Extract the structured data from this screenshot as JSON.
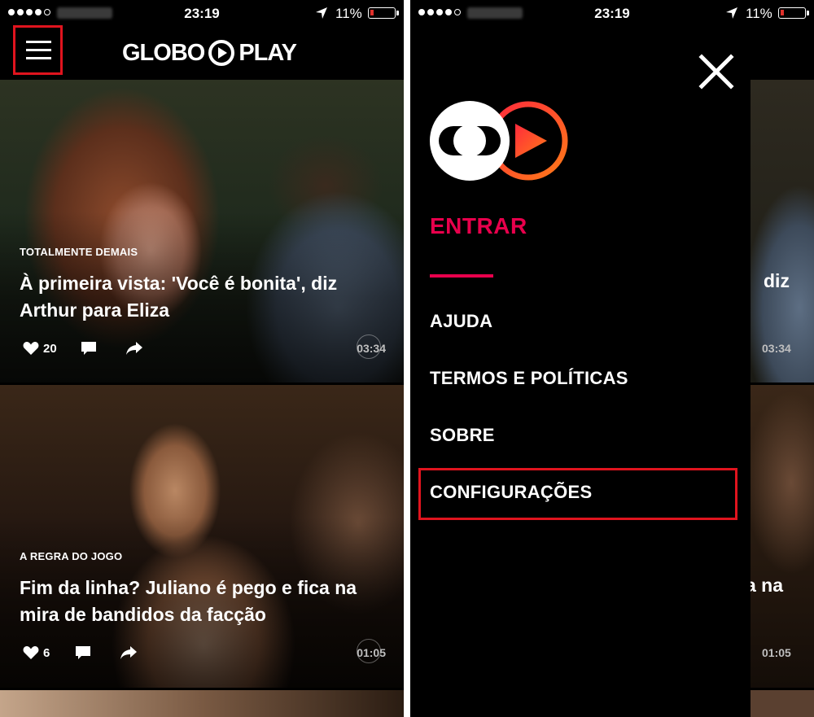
{
  "status_bar": {
    "time": "23:19",
    "battery": "11%"
  },
  "header": {
    "logo_text_left": "GLOBO",
    "logo_text_right": "PLAY"
  },
  "feed": [
    {
      "program": "TOTALMENTE DEMAIS",
      "title_line1": "À primeira vista: 'Você é bonita', diz",
      "title_line2": "Arthur para Eliza",
      "likes": "20",
      "duration": "03:34"
    },
    {
      "program": "A REGRA DO JOGO",
      "title_line1": "Fim da linha? Juliano é pego e fica na",
      "title_line2": "mira de bandidos da facção",
      "likes": "6",
      "duration": "01:05"
    }
  ],
  "peek": {
    "text1": "diz",
    "text2": "a na",
    "duration1": "03:34",
    "duration2": "01:05"
  },
  "drawer": {
    "login": "ENTRAR",
    "items": [
      "AJUDA",
      "TERMOS E POLÍTICAS",
      "SOBRE",
      "CONFIGURAÇÕES"
    ]
  },
  "colors": {
    "accent": "#e8004c",
    "highlight": "#e0141e",
    "background": "#000000"
  }
}
